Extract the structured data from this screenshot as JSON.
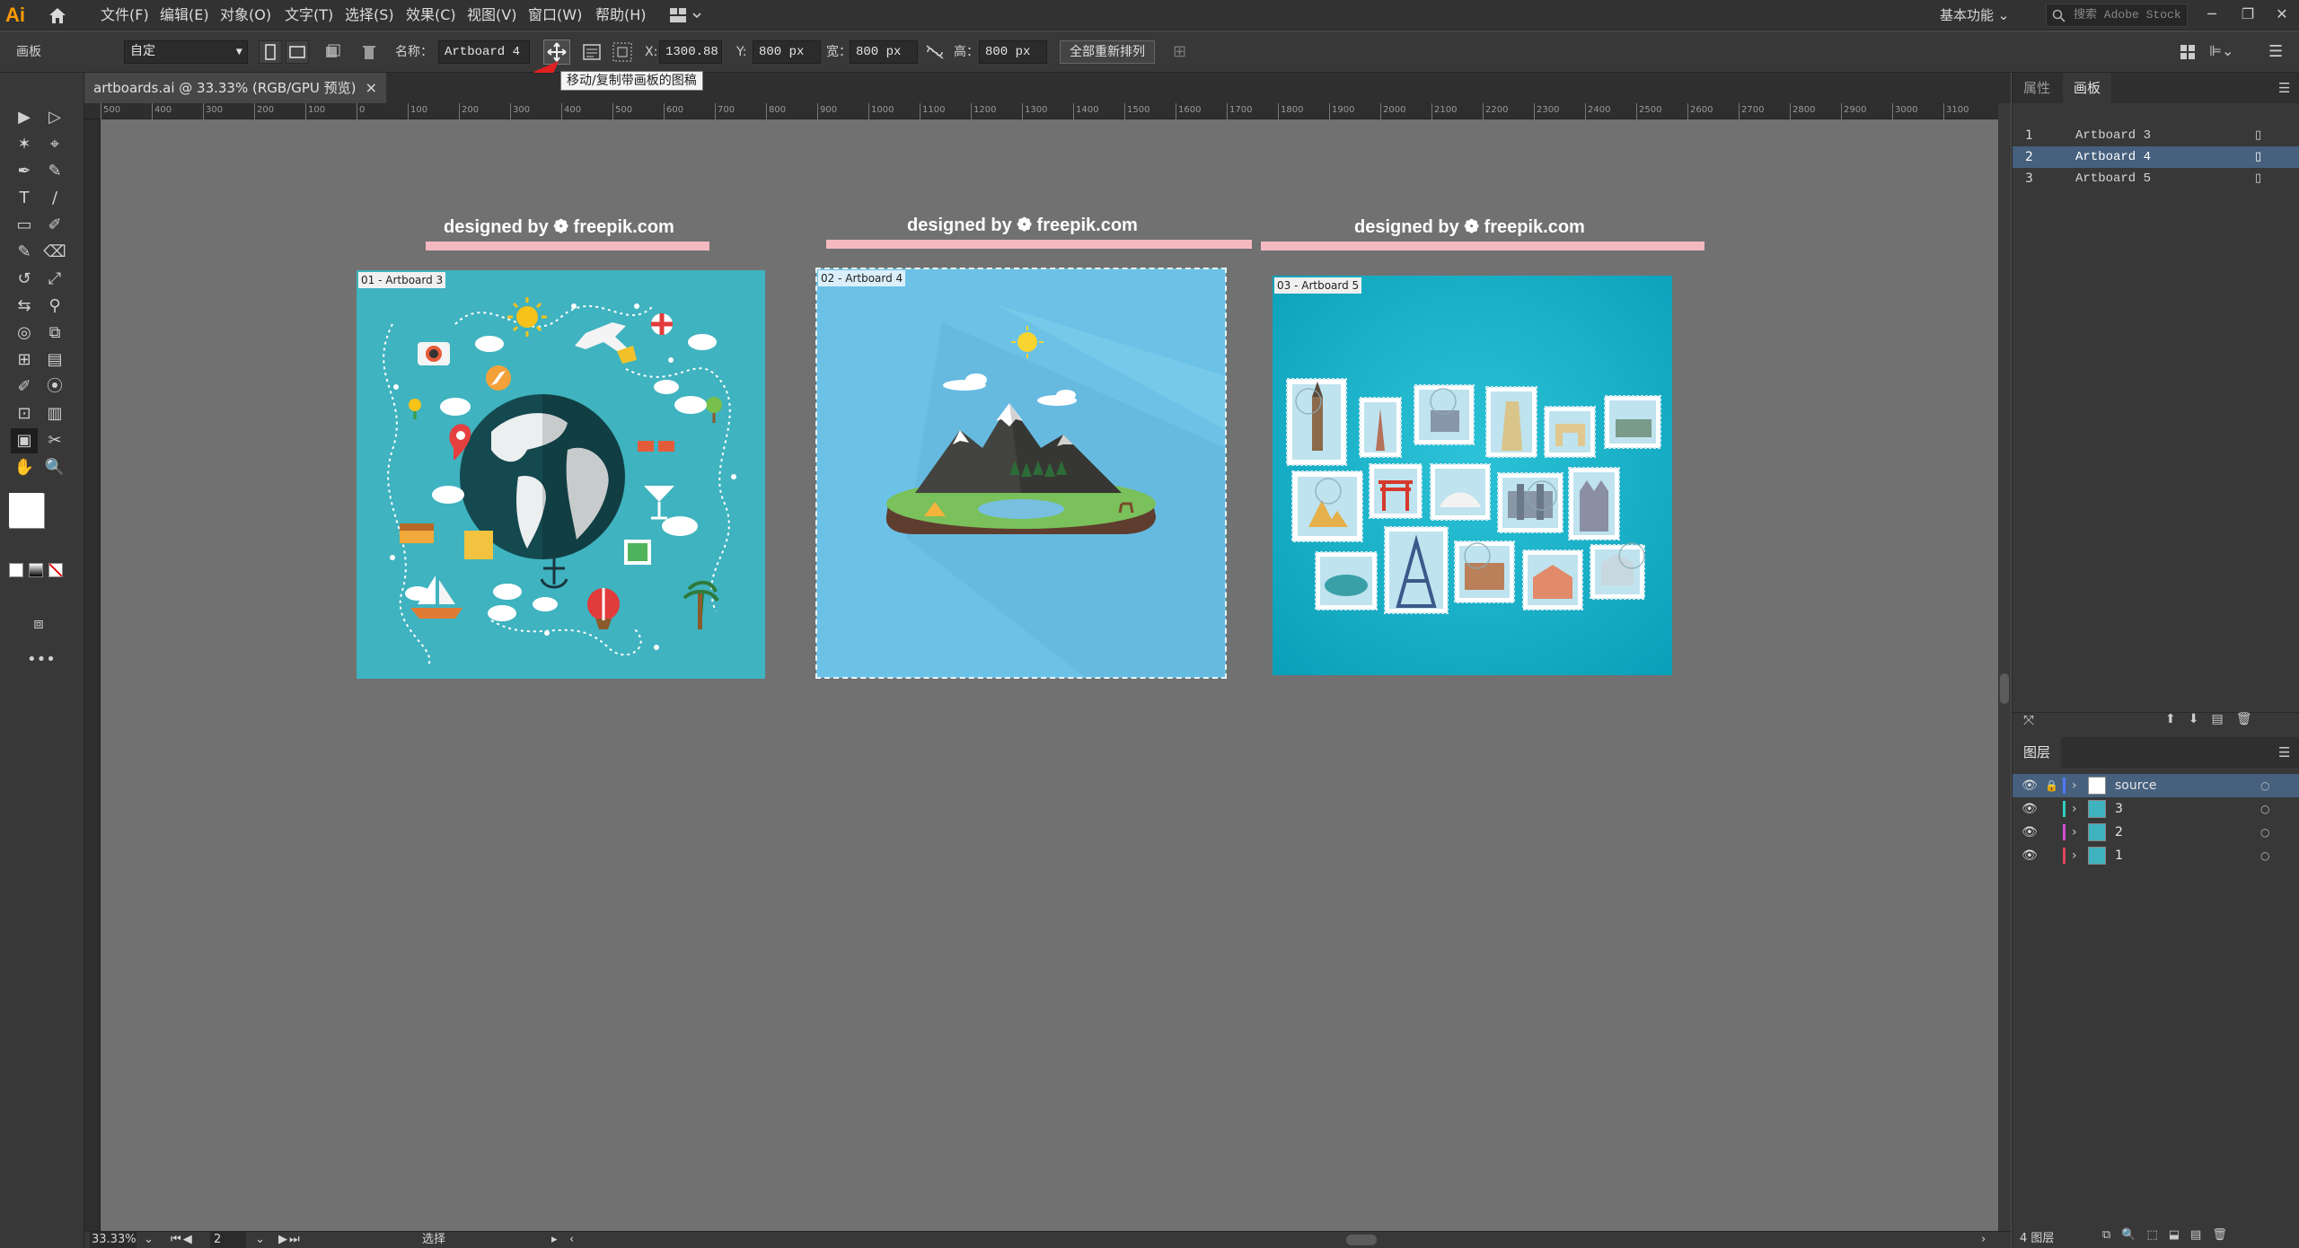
{
  "app": {
    "logo": "Ai"
  },
  "menu": {
    "items": [
      "文件(F)",
      "编辑(E)",
      "对象(O)",
      "文字(T)",
      "选择(S)",
      "效果(C)",
      "视图(V)",
      "窗口(W)",
      "帮助(H)"
    ],
    "workspace": "基本功能",
    "stock_placeholder": "搜索 Adobe Stock"
  },
  "control": {
    "mode_label": "画板",
    "preset_value": "自定",
    "name_label": "名称：",
    "name_value": "Artboard 4",
    "x_label": "X:",
    "x_value": "1300.88",
    "y_label": "Y:",
    "y_value": "800 px",
    "w_label": "宽：",
    "w_value": "800 px",
    "h_label": "高：",
    "h_value": "800 px",
    "rearrange_label": "全部重新排列",
    "tooltip": "移动/复制带画板的图稿"
  },
  "document": {
    "tab_title": "artboards.ai @ 33.33% (RGB/GPU 预览)",
    "close": "×"
  },
  "ruler_top": [
    "500",
    "400",
    "300",
    "200",
    "100",
    "0",
    "100",
    "200",
    "300",
    "400",
    "500",
    "600",
    "700",
    "800",
    "900",
    "1000",
    "1100",
    "1200",
    "1300",
    "1400",
    "1500",
    "1600",
    "1700",
    "1800",
    "1900",
    "2000",
    "2100",
    "2200",
    "2300",
    "2400",
    "2500",
    "2600",
    "2700",
    "2800",
    "2900",
    "3000",
    "3100"
  ],
  "artboards": [
    {
      "label": "01 - Artboard 3",
      "credit": "designed by ❁ freepik.com",
      "bg": "#3fb3bf"
    },
    {
      "label": "02 - Artboard 4",
      "credit": "designed by ❁ freepik.com",
      "bg": "#6cc2e6"
    },
    {
      "label": "03 - Artboard 5",
      "credit": "designed by ❁ freepik.com",
      "bg": "#16aec8"
    }
  ],
  "status": {
    "zoom": "33.33%",
    "artboard_num": "2",
    "tool": "选择"
  },
  "panel": {
    "tabs": [
      "属性",
      "画板"
    ],
    "artboards": [
      {
        "num": "1",
        "name": "Artboard 3"
      },
      {
        "num": "2",
        "name": "Artboard 4"
      },
      {
        "num": "3",
        "name": "Artboard 5"
      }
    ],
    "layers_title": "图层",
    "layers": [
      {
        "name": "source",
        "color": "#4f7bff"
      },
      {
        "name": "3",
        "color": "#2fd0c0"
      },
      {
        "name": "2",
        "color": "#d24fd2"
      },
      {
        "name": "1",
        "color": "#e0455a"
      }
    ],
    "layers_count": "4 图层"
  },
  "colors": {
    "accent_select": "#46607e",
    "arrow": "#e02020"
  }
}
